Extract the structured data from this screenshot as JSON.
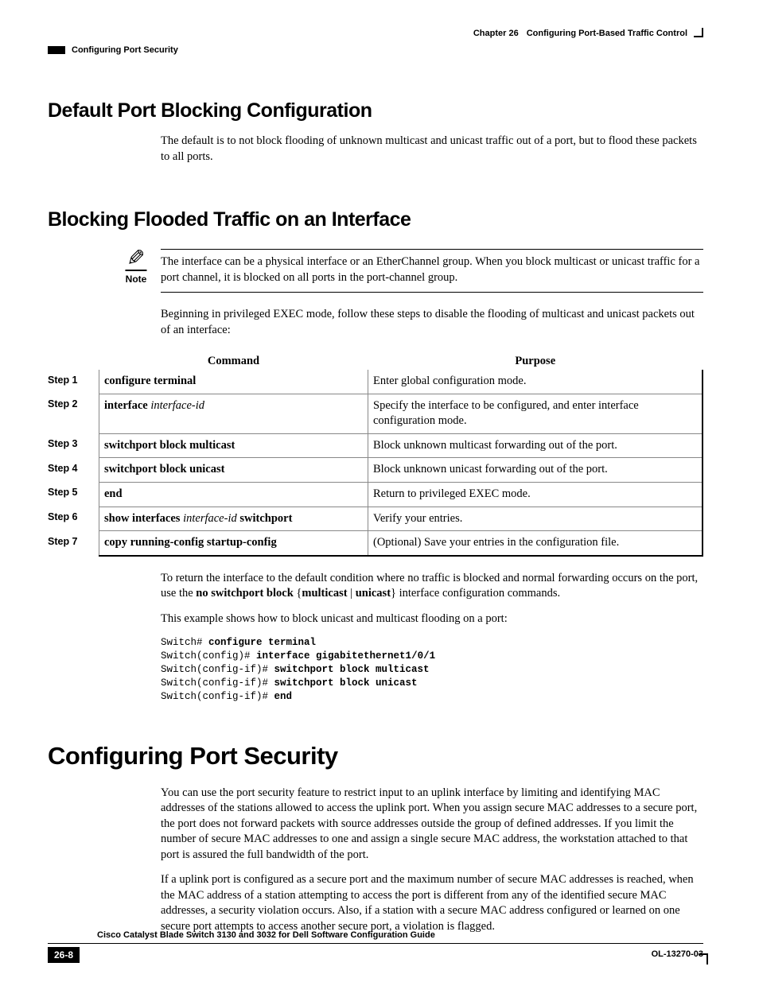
{
  "header": {
    "chapter_label": "Chapter 26",
    "chapter_title": "Configuring Port-Based Traffic Control",
    "section": "Configuring Port Security"
  },
  "sec1": {
    "title": "Default Port Blocking Configuration",
    "p1": "The default is to not block flooding of unknown multicast and unicast traffic out of a port, but to flood these packets to all ports."
  },
  "sec2": {
    "title": "Blocking Flooded Traffic on an Interface",
    "note_label": "Note",
    "note_text": "The interface can be a physical interface or an EtherChannel group. When you block multicast or unicast traffic for a port channel, it is blocked on all ports in the port-channel group.",
    "intro": "Beginning in privileged EXEC mode, follow these steps to disable the flooding of multicast and unicast packets out of an interface:",
    "table": {
      "col1": "Command",
      "col2": "Purpose",
      "rows": [
        {
          "step": "Step 1",
          "cmd_bold": "configure terminal",
          "cmd_italic": "",
          "cmd_tail": "",
          "purpose": "Enter global configuration mode."
        },
        {
          "step": "Step 2",
          "cmd_bold": "interface",
          "cmd_italic": " interface-id",
          "cmd_tail": "",
          "purpose": "Specify the interface to be configured, and enter interface configuration mode."
        },
        {
          "step": "Step 3",
          "cmd_bold": "switchport block multicast",
          "cmd_italic": "",
          "cmd_tail": "",
          "purpose": "Block unknown multicast forwarding out of the port."
        },
        {
          "step": "Step 4",
          "cmd_bold": "switchport block unicast",
          "cmd_italic": "",
          "cmd_tail": "",
          "purpose": "Block unknown unicast forwarding out of the port."
        },
        {
          "step": "Step 5",
          "cmd_bold": "end",
          "cmd_italic": "",
          "cmd_tail": "",
          "purpose": "Return to privileged EXEC mode."
        },
        {
          "step": "Step 6",
          "cmd_bold": "show interfaces",
          "cmd_italic": " interface-id",
          "cmd_tail": " switchport",
          "purpose": "Verify your entries."
        },
        {
          "step": "Step 7",
          "cmd_bold": "copy running-config startup-config",
          "cmd_italic": "",
          "cmd_tail": "",
          "purpose": "(Optional) Save your entries in the configuration file."
        }
      ]
    },
    "after1_a": "To return the interface to the default condition where no traffic is blocked and normal forwarding occurs on the port, use the ",
    "after1_b": "no switchport block",
    "after1_c": " {",
    "after1_d": "multicast",
    "after1_e": " | ",
    "after1_f": "unicast",
    "after1_g": "} interface configuration commands.",
    "after2": "This example shows how to block unicast and multicast flooding on a port:",
    "code": {
      "l1p": "Switch# ",
      "l1b": "configure terminal",
      "l2p": "Switch(config)# ",
      "l2b": "interface gigabitethernet1/0/1",
      "l3p": "Switch(config-if)# ",
      "l3b": "switchport block multicast",
      "l4p": "Switch(config-if)# ",
      "l4b": "switchport block unicast",
      "l5p": "Switch(config-if)# ",
      "l5b": "end"
    }
  },
  "sec3": {
    "title": "Configuring Port Security",
    "p1": "You can use the port security feature to restrict input to an uplink interface by limiting and identifying MAC addresses of the stations allowed to access the uplink port. When you assign secure MAC addresses to a secure port, the port does not forward packets with source addresses outside the group of defined addresses. If you limit the number of secure MAC addresses to one and assign a single secure MAC address, the workstation attached to that port is assured the full bandwidth of the port.",
    "p2": "If a uplink port is configured as a secure port and the maximum number of secure MAC addresses is reached, when the MAC address of a station attempting to access the port is different from any of the identified secure MAC addresses, a security violation occurs. Also, if a station with a secure MAC address configured or learned on one secure port attempts to access another secure port, a violation is flagged."
  },
  "footer": {
    "book_title": "Cisco Catalyst Blade Switch 3130 and 3032 for Dell Software Configuration Guide",
    "page": "26-8",
    "doc_id": "OL-13270-03"
  }
}
